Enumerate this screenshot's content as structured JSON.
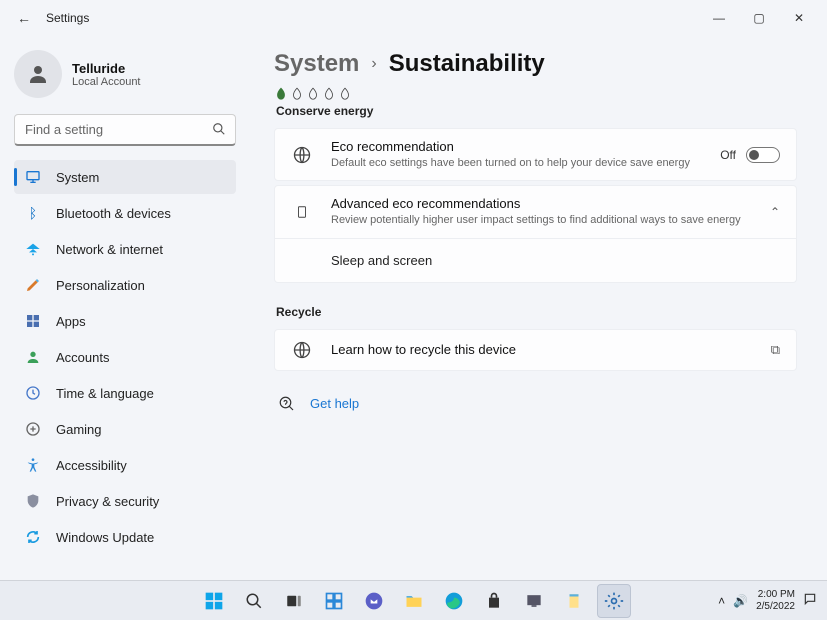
{
  "window": {
    "app_title": "Settings",
    "min": "—",
    "max": "▢",
    "close": "✕"
  },
  "user": {
    "name": "Telluride",
    "sub": "Local Account"
  },
  "search": {
    "placeholder": "Find a setting"
  },
  "nav": {
    "items": [
      {
        "label": "System",
        "active": true
      },
      {
        "label": "Bluetooth & devices"
      },
      {
        "label": "Network & internet"
      },
      {
        "label": "Personalization"
      },
      {
        "label": "Apps"
      },
      {
        "label": "Accounts"
      },
      {
        "label": "Time & language"
      },
      {
        "label": "Gaming"
      },
      {
        "label": "Accessibility"
      },
      {
        "label": "Privacy & security"
      },
      {
        "label": "Windows Update"
      }
    ]
  },
  "breadcrumb": {
    "root": "System",
    "leaf": "Sustainability"
  },
  "sections": {
    "conserve": {
      "heading": "Conserve energy",
      "eco": {
        "title": "Eco recommendation",
        "sub": "Default eco settings have been turned on to help your device save energy",
        "toggle_label": "Off"
      },
      "advanced": {
        "title": "Advanced eco recommendations",
        "sub": "Review potentially higher user impact settings to find additional ways to save energy",
        "subrow": "Sleep and screen"
      }
    },
    "recycle": {
      "heading": "Recycle",
      "card": {
        "title": "Learn how to recycle this device"
      }
    }
  },
  "help": {
    "label": "Get help"
  },
  "taskbar": {
    "time": "2:00 PM",
    "date": "2/5/2022"
  }
}
